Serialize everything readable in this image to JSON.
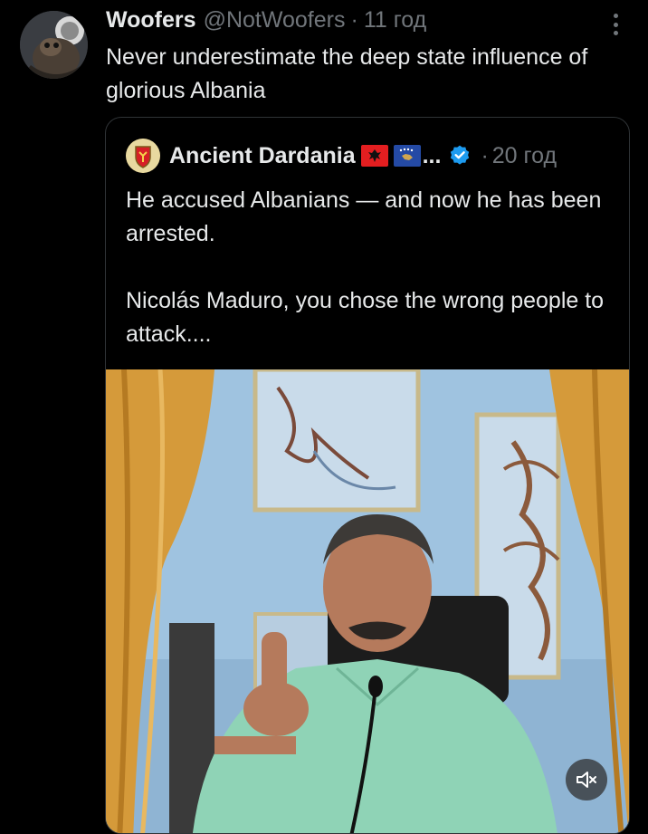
{
  "post": {
    "author_name": "Woofers",
    "author_handle": "@NotWoofers",
    "separator": "·",
    "time": "11 год",
    "text": "Never underestimate the deep state influence of glorious Albania",
    "more_icon": "more-vertical-icon"
  },
  "quoted_post": {
    "author_name": "Ancient Dardania",
    "flags": [
      "albania-flag",
      "kosovo-flag"
    ],
    "truncation": "...",
    "verified_icon": "verified-badge-icon",
    "separator": "·",
    "time": "20 год",
    "text_paragraph_1": "He accused Albanians — and now he has been arrested.",
    "text_paragraph_2": "Nicolás Maduro, you chose the wrong people to attack....",
    "media": {
      "type": "video",
      "mute_icon": "volume-muted-icon"
    }
  },
  "colors": {
    "background": "#000000",
    "primary_text": "#e7e9ea",
    "secondary_text": "#71767b",
    "border": "#2f3336",
    "verified": "#1d9bf0"
  }
}
